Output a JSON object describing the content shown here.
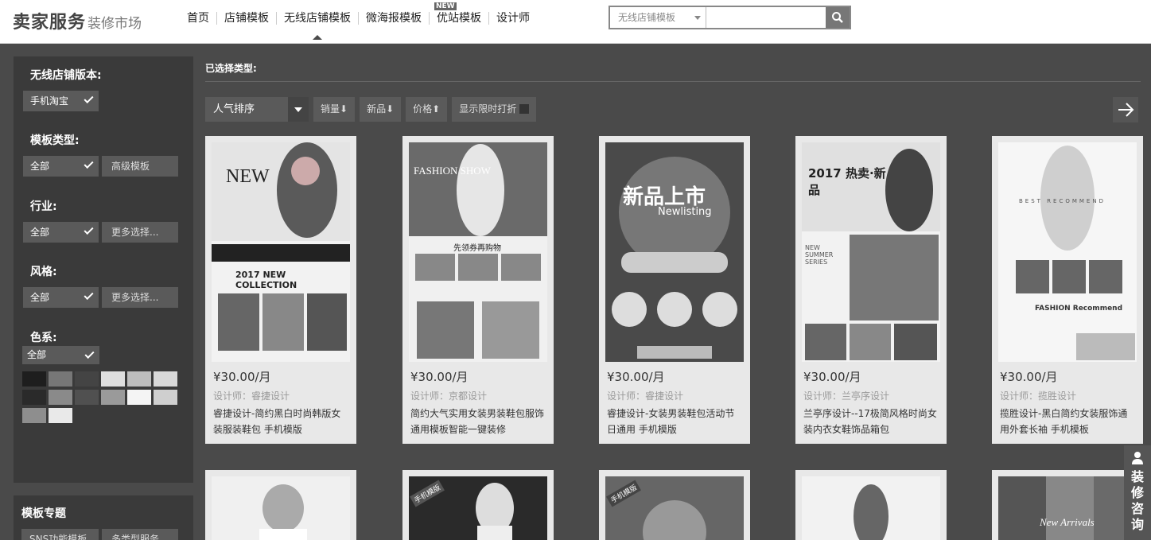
{
  "header": {
    "logo_main": "卖家服务",
    "logo_sub": "装修市场",
    "nav": [
      {
        "label": "首页",
        "badge": ""
      },
      {
        "label": "店铺模板",
        "badge": ""
      },
      {
        "label": "无线店铺模板",
        "badge": ""
      },
      {
        "label": "微海报模板",
        "badge": ""
      },
      {
        "label": "优站模板",
        "badge": "NEW"
      },
      {
        "label": "设计师",
        "badge": ""
      }
    ],
    "search_category": "无线店铺模板",
    "search_value": ""
  },
  "sidebar": {
    "version_title": "无线店铺版本:",
    "version_value": "手机淘宝",
    "type_title": "模板类型:",
    "type_value": "全部",
    "type_alt": "高级模板",
    "industry_title": "行业:",
    "industry_value": "全部",
    "industry_more": "更多选择...",
    "style_title": "风格:",
    "style_value": "全部",
    "style_more": "更多选择...",
    "color_title": "色系:",
    "color_value": "全部",
    "swatch_colors": [
      "#1e1e1e",
      "#777777",
      "#444444",
      "#dedede",
      "#bdbdbd",
      "#d8d8d8",
      "#2a2a2a",
      "#8a8a8a",
      "#505050",
      "#9a9a9a",
      "#f4f4f4",
      "#cfcfcf",
      "#8e8e8e",
      "#e9e9e9"
    ],
    "topics_title": "模板专题",
    "topics": [
      "SNS功能模板",
      "多类型服务"
    ]
  },
  "main": {
    "selected_label": "已选择类型:",
    "sort_default": "人气排序",
    "sort_buttons": [
      "销量⬇",
      "新品⬇",
      "价格⬆"
    ],
    "limited_toggle": "显示限时打折"
  },
  "cards": [
    {
      "price": "¥30.00/月",
      "designer": "设计师：睿捷设计",
      "desc": "睿捷设计-简约黑白时尚韩版女装服装鞋包 手机模版",
      "banner_title": "NEW",
      "banner_sub": "2017 NEW COLLECTION"
    },
    {
      "price": "¥30.00/月",
      "designer": "设计师：京都设计",
      "desc": "简约大气实用女装男装鞋包服饰通用模板智能一键装修",
      "banner_title": "FASHION SHOW",
      "banner_sub": "先领券再购物"
    },
    {
      "price": "¥30.00/月",
      "designer": "设计师：睿捷设计",
      "desc": "睿捷设计-女装男装鞋包活动节日通用 手机模版",
      "banner_title": "新品上市",
      "banner_sub": "Newlisting"
    },
    {
      "price": "¥30.00/月",
      "designer": "设计师：兰亭序设计",
      "desc": "兰亭序设计--17极简风格时尚女装内衣女鞋饰品箱包",
      "banner_title": "2017 热卖·新品",
      "banner_sub": "NEW SUMMER SERIES"
    },
    {
      "price": "¥30.00/月",
      "designer": "设计师：揽胜设计",
      "desc": "揽胜设计-黑白简约女装服饰通用外套长袖 手机模板",
      "banner_title": "BEST RECOMMEND",
      "banner_sub": "FASHION Recommend"
    }
  ],
  "second_row": [
    "",
    "手机模版",
    "手机模版",
    "",
    "New Arrivals"
  ],
  "consult": {
    "icon": "person-icon",
    "label": "装修咨询"
  }
}
